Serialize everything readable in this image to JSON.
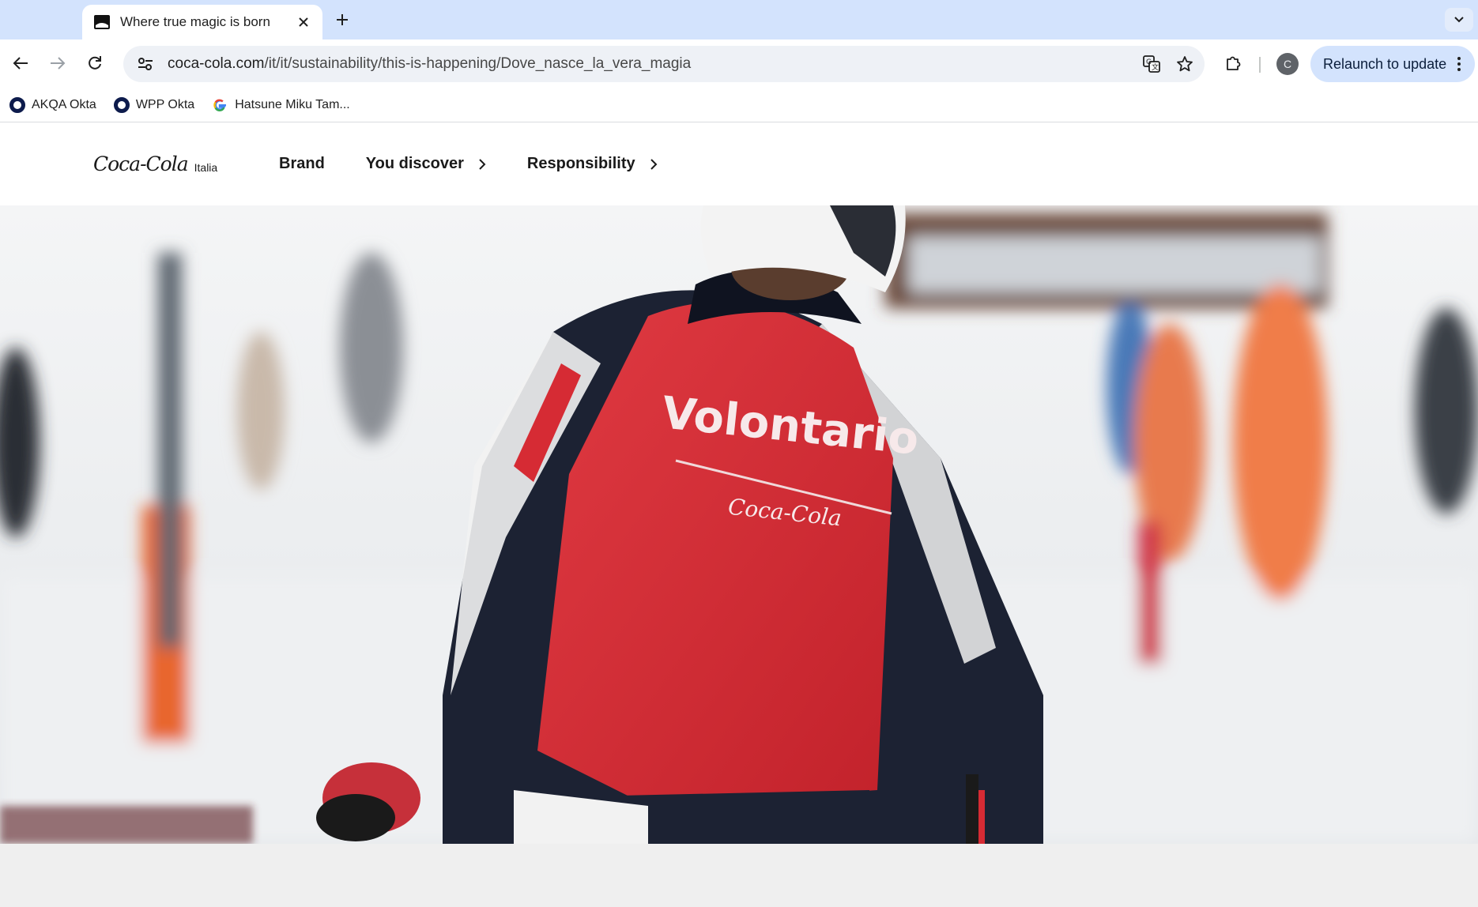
{
  "browser": {
    "tab": {
      "title": "Where true magic is born"
    },
    "url": {
      "host": "coca-cola.com",
      "path": "/it/it/sustainability/this-is-happening/Dove_nasce_la_vera_magia"
    },
    "profile_initial": "C",
    "relaunch_label": "Relaunch to update",
    "bookmarks": [
      {
        "label": "AKQA Okta",
        "icon": "okta-ring-icon"
      },
      {
        "label": "WPP Okta",
        "icon": "okta-ring-icon"
      },
      {
        "label": "Hatsune Miku Tam...",
        "icon": "google-g-icon"
      }
    ]
  },
  "site": {
    "logo": {
      "wordmark": "Coca-Cola",
      "country": "Italia"
    },
    "nav": [
      {
        "label": "Brand",
        "has_chevron": false
      },
      {
        "label": "You discover",
        "has_chevron": true
      },
      {
        "label": "Responsibility",
        "has_chevron": true
      }
    ]
  },
  "hero": {
    "vest_text": "Volontario",
    "vest_logo": "Coca-Cola",
    "colors": {
      "vest_red": "#d62b34",
      "jacket_navy": "#1c2233",
      "snow": "#eef0f2"
    }
  }
}
